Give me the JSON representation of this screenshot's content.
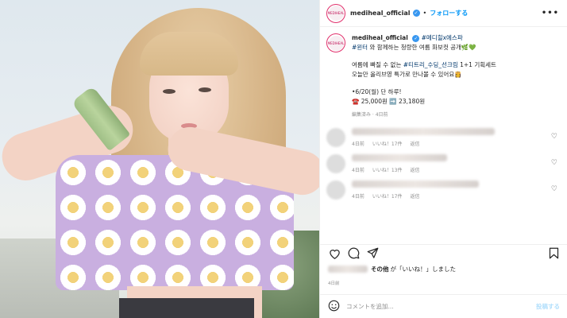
{
  "header": {
    "avatar_text": "MEDIHEAL",
    "username": "mediheal_official",
    "separator": "•",
    "follow_label": "フォローする",
    "more_label": "•••"
  },
  "caption": {
    "username": "mediheal_official",
    "hashtags_line1": "#메디힐x에스파",
    "line2_tag": "#윈터",
    "line2_text": " 와 함께하는 청량한 여름 화보컷 공개🌿💚",
    "line3_pre": "여름에 빠질 수 없는 ",
    "line3_tag": "#티트리_수딩_선크림",
    "line3_post": " 1+1 기획세트",
    "line4": "오늘만 올리브영 특가로 만나볼 수 있어요👸",
    "line5": "•6/20(월) 단 하루!",
    "line6": "☎️ 25,000원 ➡️ 23,180원",
    "meta": "編集済み · 4日前"
  },
  "comments": [
    {
      "time": "4日前",
      "likes": "いいね！17件",
      "reply": "返信"
    },
    {
      "time": "4日前",
      "likes": "いいね！13件",
      "reply": "返信"
    },
    {
      "time": "4日前",
      "likes": "いいね！17件",
      "reply": "返信"
    }
  ],
  "likes_summary": {
    "middle": "その他",
    "suffix": "が「いいね！」しました"
  },
  "post_date": "4日前",
  "composer": {
    "placeholder": "コメントを追加...",
    "post_label": "投稿する"
  },
  "colors": {
    "accent": "#0095f6",
    "hashtag": "#00376b",
    "muted": "#8e8e8e",
    "verified": "#3897f0"
  }
}
